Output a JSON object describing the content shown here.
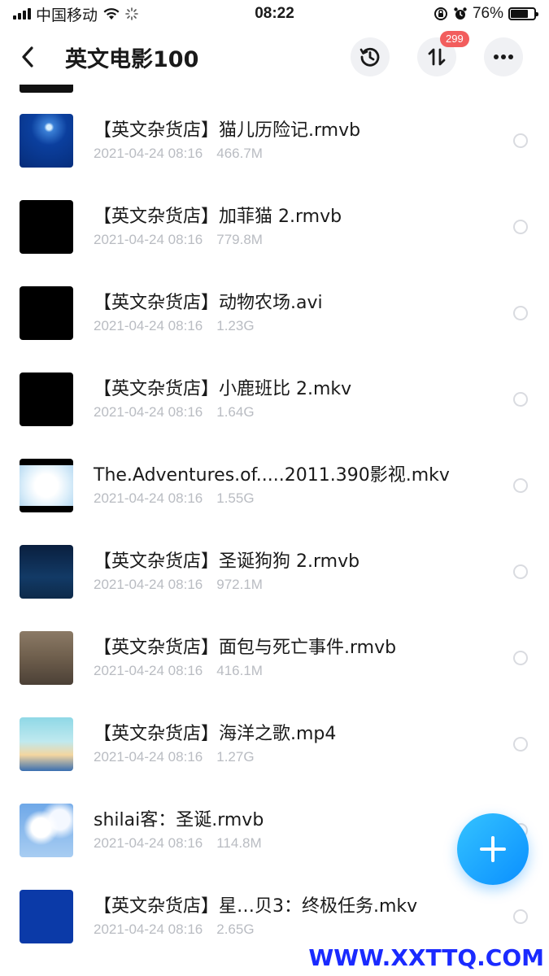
{
  "status_bar": {
    "carrier": "中国移动",
    "time": "08:22",
    "battery_percent": "76%",
    "battery_level": 0.76
  },
  "header": {
    "title": "英文电影100",
    "transfer_badge": "299",
    "icons": [
      "back-arrow-icon",
      "history-icon",
      "transfer-icon",
      "more-icon"
    ]
  },
  "files": [
    {
      "name": "【英文杂货店】猫儿历险记.rmvb",
      "date": "2021-04-24 08:16",
      "size": "466.7M",
      "thumb": "blue-space"
    },
    {
      "name": "【英文杂货店】加菲猫 2.rmvb",
      "date": "2021-04-24 08:16",
      "size": "779.8M",
      "thumb": "black-caption"
    },
    {
      "name": "【英文杂货店】动物农场.avi",
      "date": "2021-04-24 08:16",
      "size": "1.23G",
      "thumb": "black"
    },
    {
      "name": "【英文杂货店】小鹿班比 2.mkv",
      "date": "2021-04-24 08:16",
      "size": "1.64G",
      "thumb": "black"
    },
    {
      "name": "The.Adventures.of.....2011.390影视.mkv",
      "date": "2021-04-24 08:16",
      "size": "1.55G",
      "thumb": "white-glow"
    },
    {
      "name": "【英文杂货店】圣诞狗狗 2.rmvb",
      "date": "2021-04-24 08:16",
      "size": "972.1M",
      "thumb": "night-sky"
    },
    {
      "name": "【英文杂货店】面包与死亡事件.rmvb",
      "date": "2021-04-24 08:16",
      "size": "416.1M",
      "thumb": "brown"
    },
    {
      "name": "【英文杂货店】海洋之歌.mp4",
      "date": "2021-04-24 08:16",
      "size": "1.27G",
      "thumb": "cartoon"
    },
    {
      "name": "shilai客：圣诞.rmvb",
      "date": "2021-04-24 08:16",
      "size": "114.8M",
      "thumb": "clouds"
    },
    {
      "name": "【英文杂货店】星…贝3：终极任务.mkv",
      "date": "2021-04-24 08:16",
      "size": "2.65G",
      "thumb": "solid-blue"
    }
  ],
  "fab": {
    "icon": "plus-icon"
  },
  "watermark": "WWW.XXTTQ.COM",
  "colors": {
    "accent": "#1aa3ff",
    "meta_text": "#b9bcc2",
    "badge": "#f25d5d",
    "watermark": "#1a2aff"
  }
}
